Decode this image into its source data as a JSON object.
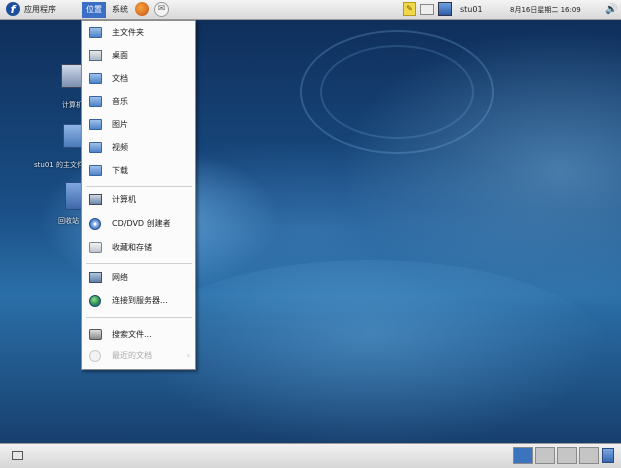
{
  "top_panel": {
    "applications_label": "应用程序",
    "places_label": "位置",
    "system_label": "系统",
    "username": "stu01",
    "clock": "8月16日星期二 16:09"
  },
  "desktop": {
    "icons": [
      {
        "label": "计算机"
      },
      {
        "label": "stu01 的主文件夹"
      },
      {
        "label": "回收站"
      }
    ]
  },
  "places_menu": {
    "items": [
      {
        "label": "主文件夹",
        "icon": "home-folder-icon"
      },
      {
        "label": "桌面",
        "icon": "desktop-icon"
      },
      {
        "label": "文档",
        "icon": "folder-icon"
      },
      {
        "label": "音乐",
        "icon": "folder-icon"
      },
      {
        "label": "图片",
        "icon": "folder-icon"
      },
      {
        "label": "视频",
        "icon": "folder-icon"
      },
      {
        "label": "下载",
        "icon": "folder-icon"
      },
      {
        "label": "计算机",
        "icon": "computer-icon"
      },
      {
        "label": "CD/DVD 创建者",
        "icon": "disc-icon"
      },
      {
        "label": "收藏和存储",
        "icon": "burn-icon"
      },
      {
        "label": "网络",
        "icon": "network-icon"
      },
      {
        "label": "连接到服务器...",
        "icon": "globe-icon"
      },
      {
        "label": "搜索文件...",
        "icon": "search-icon"
      },
      {
        "label": "最近的文档",
        "icon": "recent-icon"
      }
    ]
  },
  "colors": {
    "places_highlight": "#3b6fc6",
    "active_workspace": "#3c73bf",
    "desktop_dark": "#0f2f5c"
  }
}
